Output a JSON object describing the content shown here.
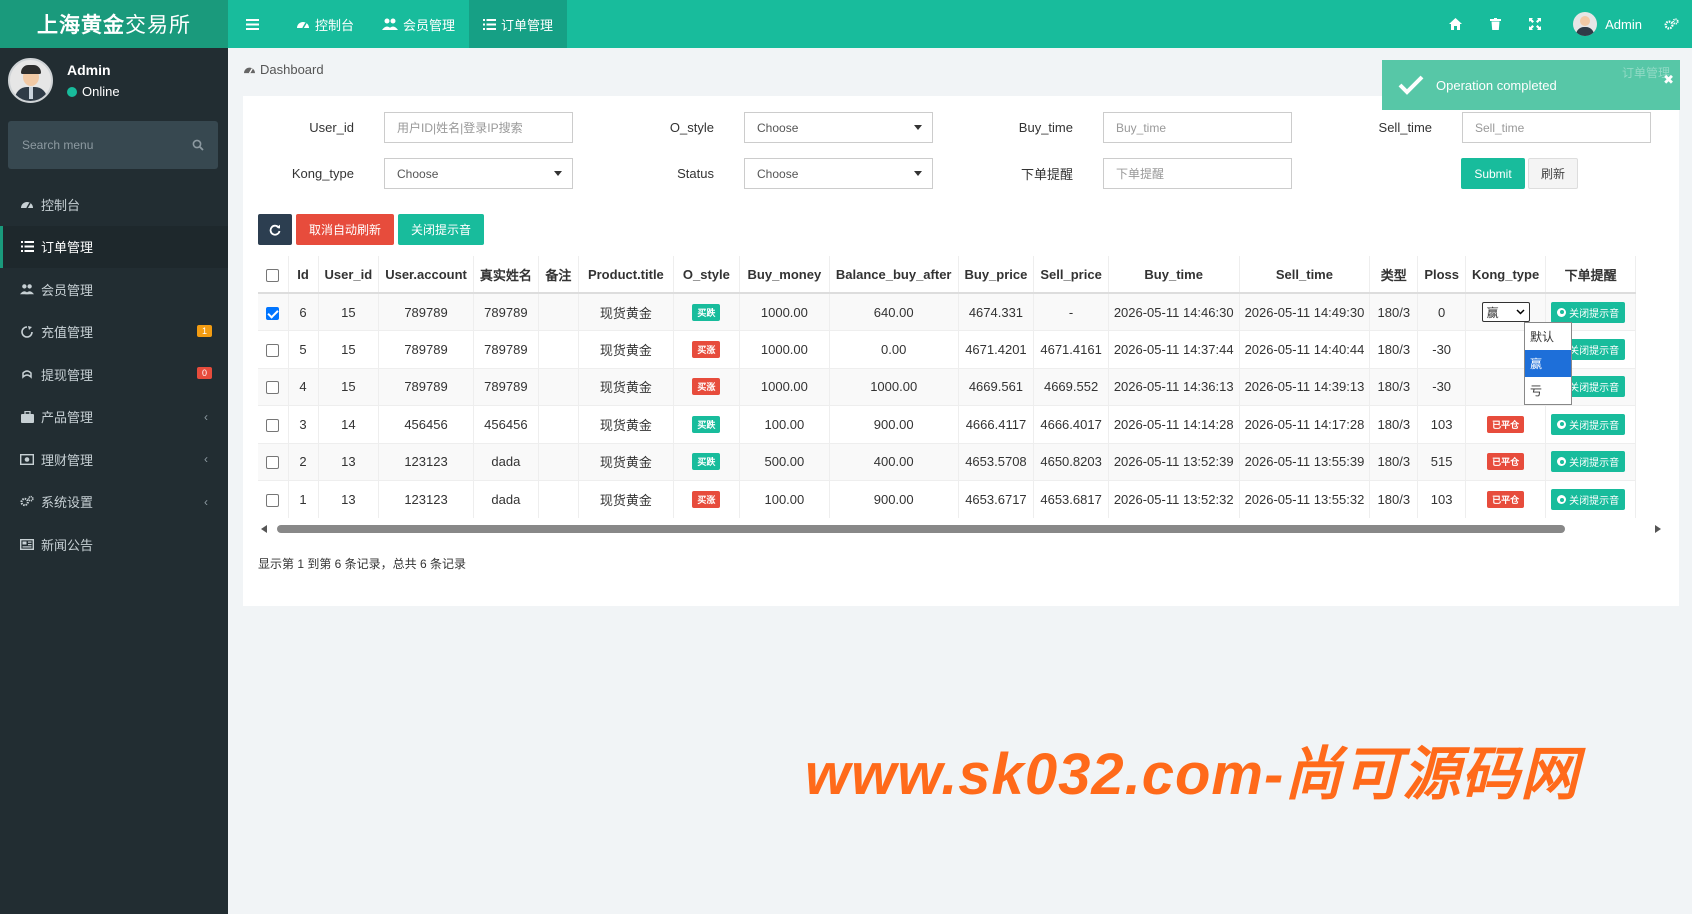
{
  "app": {
    "logo_bold": "上海黄金",
    "logo_rest": "交易所"
  },
  "user": {
    "name": "Admin",
    "status": "Online"
  },
  "search": {
    "placeholder": "Search menu"
  },
  "menu": [
    {
      "label": "控制台",
      "icon": "dashboard-icon"
    },
    {
      "label": "订单管理",
      "icon": "list-icon",
      "active": true
    },
    {
      "label": "会员管理",
      "icon": "users-icon"
    },
    {
      "label": "充值管理",
      "icon": "recharge-icon",
      "badge": "1",
      "badge_color": "#f39c12"
    },
    {
      "label": "提现管理",
      "icon": "withdraw-icon",
      "badge": "0",
      "badge_color": "#e74c3c"
    },
    {
      "label": "产品管理",
      "icon": "briefcase-icon",
      "caret": "‹"
    },
    {
      "label": "理财管理",
      "icon": "money-icon",
      "caret": "‹"
    },
    {
      "label": "系统设置",
      "icon": "cogs-icon",
      "caret": "‹"
    },
    {
      "label": "新闻公告",
      "icon": "newspaper-icon"
    }
  ],
  "topbar": {
    "tabs": [
      {
        "label": "控制台"
      },
      {
        "label": "会员管理"
      },
      {
        "label": "订单管理"
      }
    ],
    "user_name": "Admin"
  },
  "breadcrumb": "Dashboard",
  "filters": {
    "user_id_label": "User_id",
    "user_id_placeholder": "用户ID|姓名|登录IP搜索",
    "o_style_label": "O_style",
    "o_style_value": "Choose",
    "buy_time_label": "Buy_time",
    "buy_time_placeholder": "Buy_time",
    "sell_time_label": "Sell_time",
    "sell_time_placeholder": "Sell_time",
    "kong_type_label": "Kong_type",
    "kong_type_value": "Choose",
    "status_label": "Status",
    "status_value": "Choose",
    "reminder_label": "下单提醒",
    "reminder_placeholder": "下单提醒",
    "submit": "Submit",
    "reset": "刷新"
  },
  "toolbar": {
    "cancel_auto_refresh": "取消自动刷新",
    "close_sound": "关闭提示音"
  },
  "table": {
    "headers": [
      "Id",
      "User_id",
      "User.account",
      "真实姓名",
      "备注",
      "Product.title",
      "O_style",
      "Buy_money",
      "Balance_buy_after",
      "Buy_price",
      "Sell_price",
      "Buy_time",
      "Sell_time",
      "类型",
      "Ploss",
      "Kong_type",
      "下单提醒"
    ],
    "rows": [
      {
        "id": "6",
        "user_id": "15",
        "account": "789789",
        "name": "789789",
        "note": "",
        "product": "现货黄金",
        "o_style": "买跌",
        "o_color": "green",
        "buy_money": "1000.00",
        "balance": "640.00",
        "buy_price": "4674.331",
        "sell_price": "-",
        "buy_time": "2026-05-11 14:46:30",
        "sell_time": "2026-05-11 14:49:30",
        "type": "180/3",
        "ploss": "0",
        "kong_type": "赢",
        "action": "关闭提示音"
      },
      {
        "id": "5",
        "user_id": "15",
        "account": "789789",
        "name": "789789",
        "note": "",
        "product": "现货黄金",
        "o_style": "买涨",
        "o_color": "red",
        "buy_money": "1000.00",
        "balance": "0.00",
        "buy_price": "4671.4201",
        "sell_price": "4671.4161",
        "buy_time": "2026-05-11 14:37:44",
        "sell_time": "2026-05-11 14:40:44",
        "type": "180/3",
        "ploss": "-30",
        "kong_type": "",
        "action": "关闭提示音"
      },
      {
        "id": "4",
        "user_id": "15",
        "account": "789789",
        "name": "789789",
        "note": "",
        "product": "现货黄金",
        "o_style": "买涨",
        "o_color": "red",
        "buy_money": "1000.00",
        "balance": "1000.00",
        "buy_price": "4669.561",
        "sell_price": "4669.552",
        "buy_time": "2026-05-11 14:36:13",
        "sell_time": "2026-05-11 14:39:13",
        "type": "180/3",
        "ploss": "-30",
        "kong_type": "",
        "action": "关闭提示音"
      },
      {
        "id": "3",
        "user_id": "14",
        "account": "456456",
        "name": "456456",
        "note": "",
        "product": "现货黄金",
        "o_style": "买跌",
        "o_color": "green",
        "buy_money": "100.00",
        "balance": "900.00",
        "buy_price": "4666.4117",
        "sell_price": "4666.4017",
        "buy_time": "2026-05-11 14:14:28",
        "sell_time": "2026-05-11 14:17:28",
        "type": "180/3",
        "ploss": "103",
        "kong_type": "已平仓",
        "action": "关闭提示音"
      },
      {
        "id": "2",
        "user_id": "13",
        "account": "123123",
        "name": "dada",
        "note": "",
        "product": "现货黄金",
        "o_style": "买跌",
        "o_color": "green",
        "buy_money": "500.00",
        "balance": "400.00",
        "buy_price": "4653.5708",
        "sell_price": "4650.8203",
        "buy_time": "2026-05-11 13:52:39",
        "sell_time": "2026-05-11 13:55:39",
        "type": "180/3",
        "ploss": "515",
        "kong_type": "已平仓",
        "action": "关闭提示音"
      },
      {
        "id": "1",
        "user_id": "13",
        "account": "123123",
        "name": "dada",
        "note": "",
        "product": "现货黄金",
        "o_style": "买涨",
        "o_color": "red",
        "buy_money": "100.00",
        "balance": "900.00",
        "buy_price": "4653.6717",
        "sell_price": "4653.6817",
        "buy_time": "2026-05-11 13:52:32",
        "sell_time": "2026-05-11 13:55:32",
        "type": "180/3",
        "ploss": "103",
        "kong_type": "已平仓",
        "action": "关闭提示音"
      }
    ]
  },
  "dropdown": {
    "options": [
      "默认",
      "赢",
      "亏"
    ],
    "highlighted": "赢"
  },
  "pagination": "显示第 1 到第 6 条记录，总共 6 条记录",
  "toast": {
    "message": "Operation completed",
    "ghost": "订单管理"
  },
  "watermark": "www.sk032.com-尚可源码网",
  "colors": {
    "primary": "#18bc9c",
    "danger": "#e74c3c",
    "dark": "#2c3e50",
    "sidebar": "#222d32"
  }
}
